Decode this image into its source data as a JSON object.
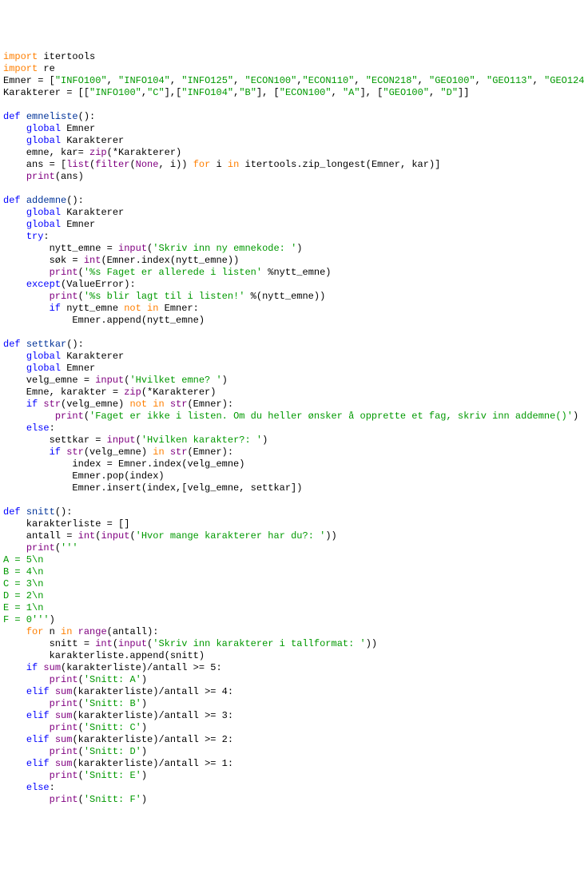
{
  "code": {
    "imports": [
      "itertools",
      "re"
    ],
    "emner_list": [
      "INFO100",
      "INFO104",
      "INFO125",
      "ECON100",
      "ECON110",
      "ECON218",
      "GEO100",
      "GEO113",
      "GEO124"
    ],
    "karakterer_list": [
      [
        "INFO100",
        "C"
      ],
      [
        "INFO104",
        "B"
      ],
      [
        "ECON100",
        "A"
      ],
      [
        "GEO100",
        "D"
      ]
    ],
    "functions": {
      "emneliste": {
        "name": "emneliste",
        "globals": [
          "Emner",
          "Karakterer"
        ],
        "line_zip": "emne, kar= zip(*Karakterer)",
        "line_ans": "ans = [list(filter(None, i)) for i in itertools.zip_longest(Emner, kar)]",
        "line_print": "print(ans)"
      },
      "addemne": {
        "name": "addemne",
        "globals": [
          "Karakterer",
          "Emner"
        ],
        "prompt_new": "Skriv inn ny emnekode: ",
        "msg_already": "%s Faget er allerede i listen",
        "msg_added": "%s blir lagt til i listen!",
        "except_name": "ValueError"
      },
      "settkar": {
        "name": "settkar",
        "globals": [
          "Karakterer",
          "Emner"
        ],
        "prompt_subject": "Hvilket emne? ",
        "msg_notin": "Faget er ikke i listen. Om du heller ønsker å opprette et fag, skriv inn addemne()",
        "prompt_grade": "Hvilken karakter?: "
      },
      "snitt": {
        "name": "snitt",
        "prompt_count": "Hvor mange karakterer har du?: ",
        "scale_text": "A = 5\\n\\nB = 4\\n\\nC = 3\\n\\nD = 2\\n\\nE = 1\\n\\nF = 0",
        "prompt_grade_num": "Skriv inn karakterer i tallformat: ",
        "thresholds": [
          {
            "min": 5,
            "label": "Snitt: A"
          },
          {
            "min": 4,
            "label": "Snitt: B"
          },
          {
            "min": 3,
            "label": "Snitt: C"
          },
          {
            "min": 2,
            "label": "Snitt: D"
          },
          {
            "min": 1,
            "label": "Snitt: E"
          }
        ],
        "else_label": "Snitt: F"
      }
    }
  }
}
